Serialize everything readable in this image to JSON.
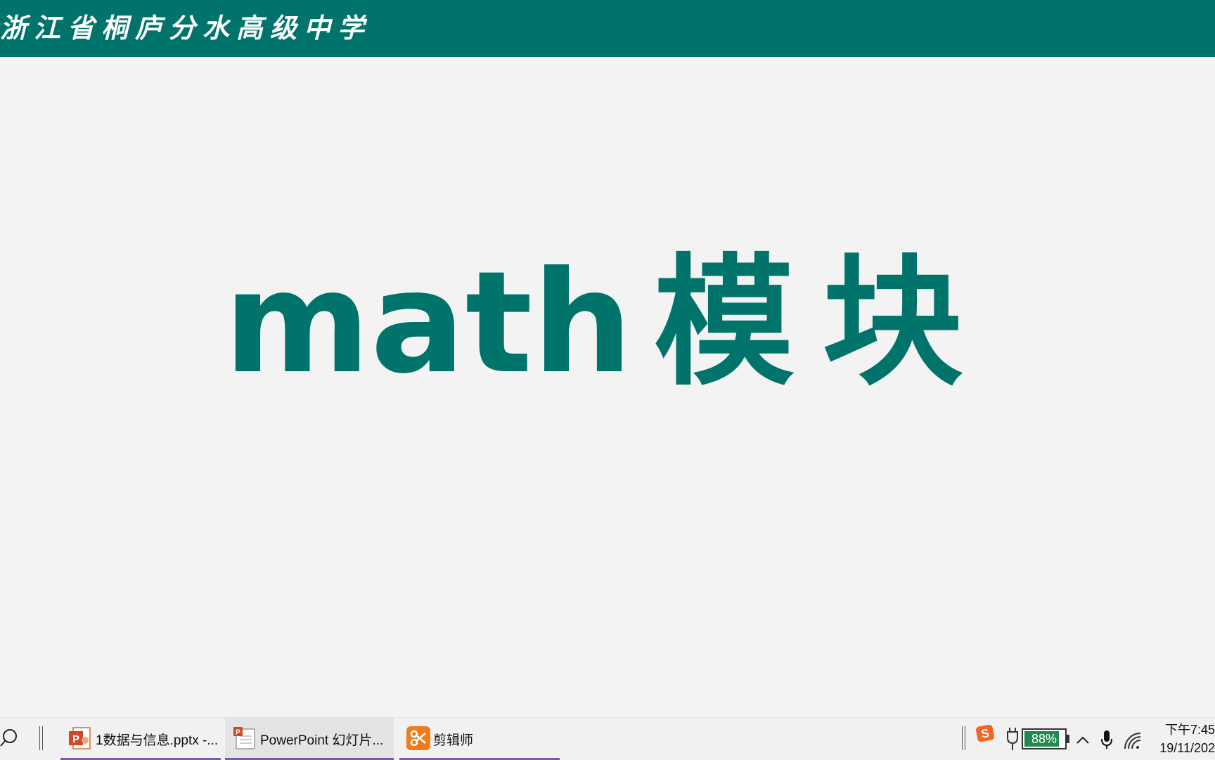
{
  "slide": {
    "school_name": "浙江省桐庐分水高级中学",
    "title_latin": "math",
    "title_cjk": "模块"
  },
  "colors": {
    "brand": "#00736b",
    "background": "#f3f3f3",
    "taskbar_accent": "#7a5aa6",
    "battery_fill": "#1f8a4c"
  },
  "taskbar": {
    "search_icon": "search-icon",
    "apps": [
      {
        "label": "1数据与信息.pptx -...",
        "icon": "powerpoint-icon"
      },
      {
        "label": "PowerPoint 幻灯片...",
        "icon": "powerpoint-slideshow-icon"
      },
      {
        "label": "剪辑师",
        "icon": "video-editor-icon"
      }
    ],
    "tray": {
      "ime_icon": "sogou-ime-icon",
      "power_icon": "power-plug-icon",
      "battery_text": "88%",
      "battery_level": 0.88,
      "chevron_icon": "chevron-up-icon",
      "mic_icon": "microphone-icon",
      "wifi_icon": "wifi-icon",
      "time": "下午7:45",
      "date": "19/11/202"
    }
  }
}
